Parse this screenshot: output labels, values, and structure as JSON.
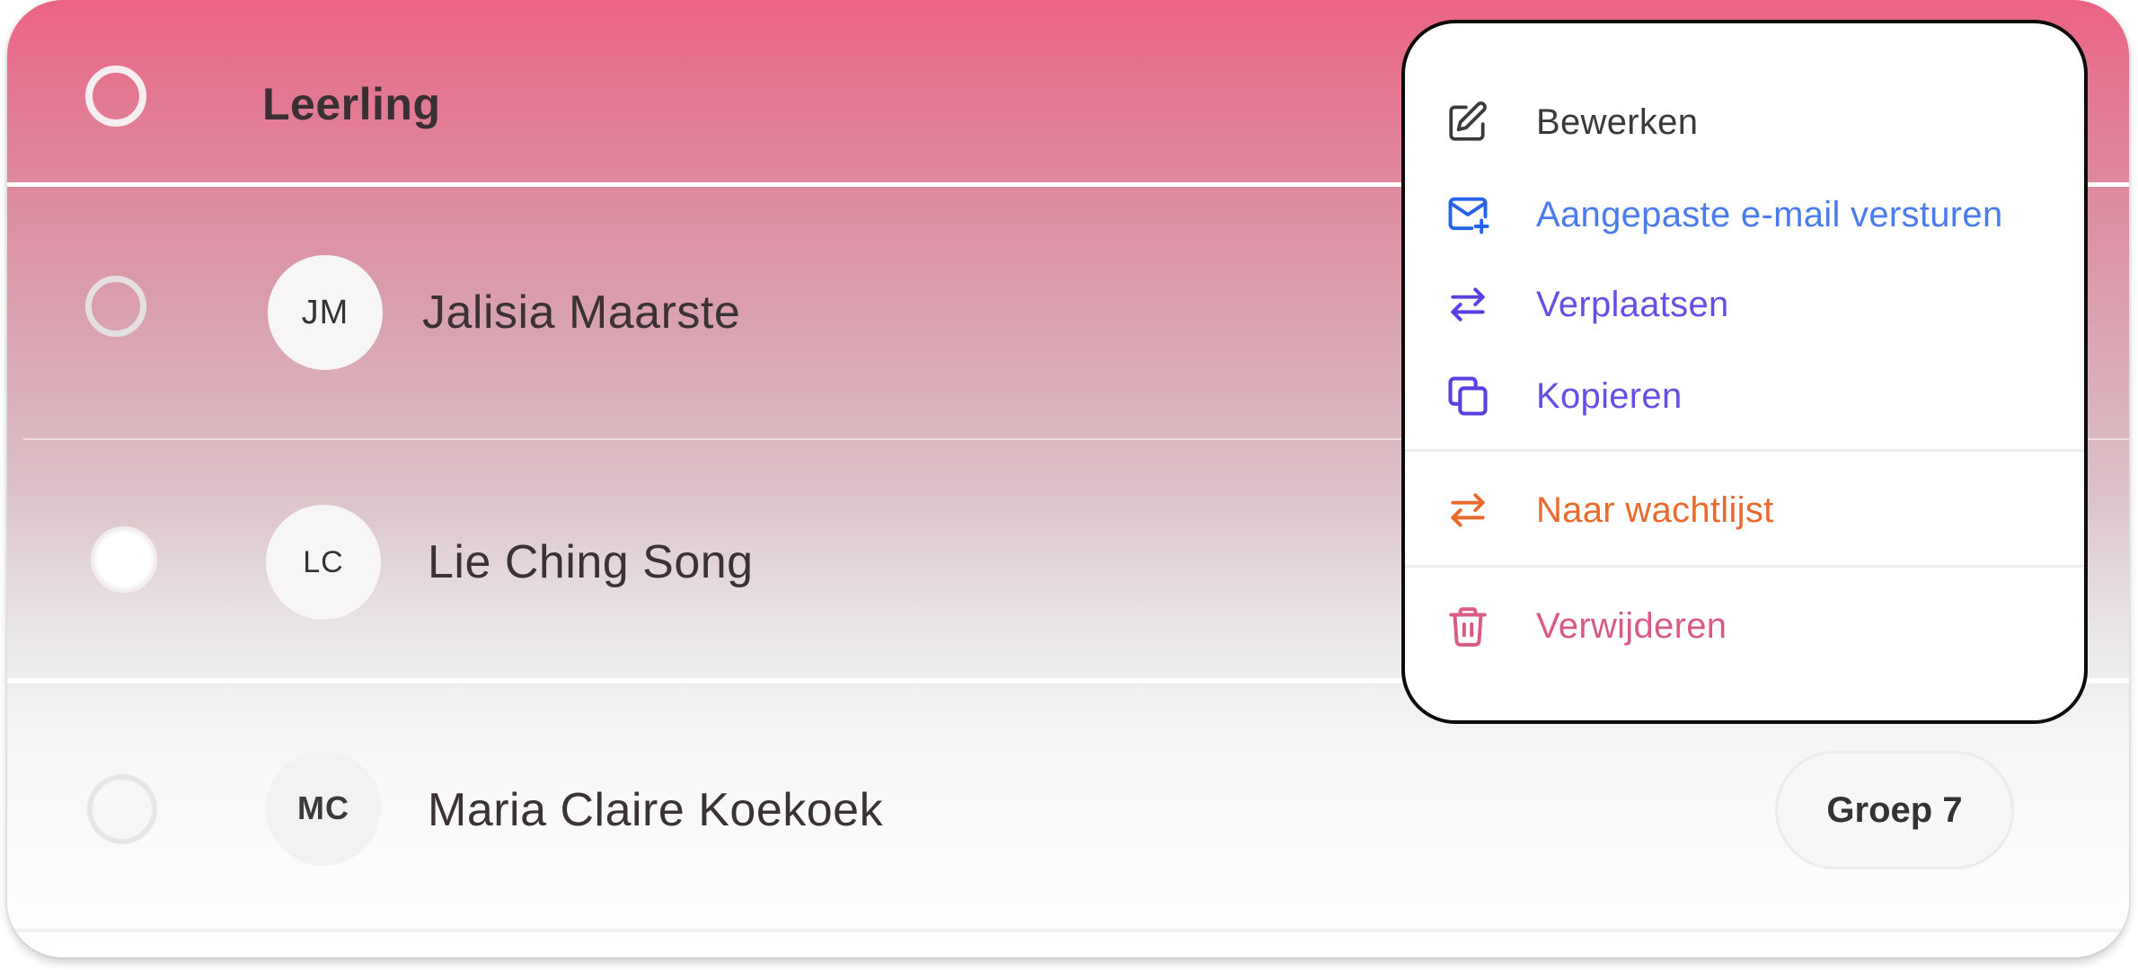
{
  "table": {
    "header_title": "Leerling",
    "rows": [
      {
        "initials": "JM",
        "name": "Jalisia Maarste"
      },
      {
        "initials": "LC",
        "name": "Lie Ching Song"
      },
      {
        "initials": "MC",
        "name": "Maria Claire Koekoek",
        "group": "Groep 7"
      }
    ]
  },
  "context_menu": {
    "items": [
      {
        "label": "Bewerken",
        "icon": "pencil-square-icon",
        "color": "#3a3a3a"
      },
      {
        "label": "Aangepaste e-mail versturen",
        "icon": "mail-plus-icon",
        "color": "#4a7cf0"
      },
      {
        "label": "Verplaatsen",
        "icon": "arrows-swap-icon",
        "color": "#6a4de6"
      },
      {
        "label": "Kopieren",
        "icon": "copy-icon",
        "color": "#6a4de6"
      },
      {
        "label": "Naar wachtlijst",
        "icon": "arrows-swap-icon",
        "color": "#ea6a2e"
      },
      {
        "label": "Verwijderen",
        "icon": "trash-icon",
        "color": "#d95a86"
      }
    ]
  },
  "colors": {
    "header_gradient_top": "#ec6383",
    "menu_border": "#0c0c0c",
    "text_dark": "#3a3235"
  }
}
